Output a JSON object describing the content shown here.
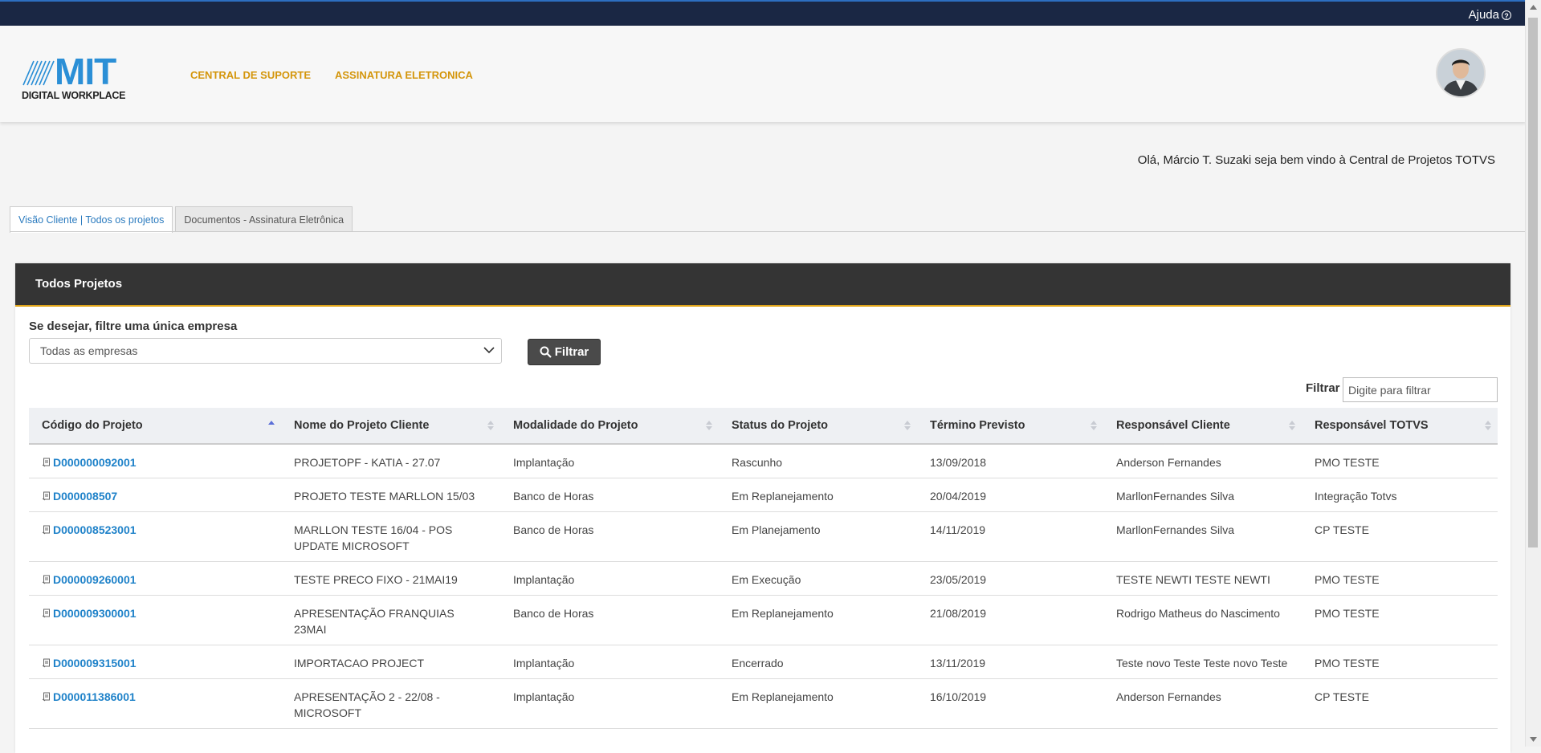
{
  "topbar": {
    "help_label": "Ajuda",
    "help_icon": "question-circle-icon"
  },
  "header": {
    "logo": {
      "brand": "MIT",
      "subtitle": "DIGITAL WORKPLACE"
    },
    "nav": [
      {
        "label": "CENTRAL DE SUPORTE"
      },
      {
        "label": "ASSINATURA ELETRONICA"
      }
    ]
  },
  "welcome_text": "Olá, Márcio T. Suzaki seja bem vindo à Central de Projetos TOTVS",
  "tabs": [
    {
      "label": "Visão Cliente | Todos os projetos",
      "active": true
    },
    {
      "label": "Documentos - Assinatura Eletrônica",
      "active": false
    }
  ],
  "panel": {
    "title": "Todos Projetos",
    "company_filter_label": "Se desejar, filtre uma única empresa",
    "company_select_value": "Todas as empresas",
    "filter_button": "Filtrar",
    "search_label": "Filtrar",
    "search_placeholder": "Digite para filtrar"
  },
  "table": {
    "columns": [
      "Código do Projeto",
      "Nome do Projeto Cliente",
      "Modalidade do Projeto",
      "Status do Projeto",
      "Término Previsto",
      "Responsável Cliente",
      "Responsável TOTVS"
    ],
    "rows": [
      [
        "D000000092001",
        "PROJETOPF - KATIA - 27.07",
        "Implantação",
        "Rascunho",
        "13/09/2018",
        "Anderson Fernandes",
        "PMO TESTE"
      ],
      [
        "D000008507",
        "PROJETO TESTE MARLLON 15/03",
        "Banco de Horas",
        "Em Replanejamento",
        "20/04/2019",
        "MarllonFernandes Silva",
        "Integração Totvs"
      ],
      [
        "D000008523001",
        "MARLLON TESTE 16/04 - POS UPDATE MICROSOFT",
        "Banco de Horas",
        "Em Planejamento",
        "14/11/2019",
        "MarllonFernandes Silva",
        "CP TESTE"
      ],
      [
        "D000009260001",
        "TESTE PRECO FIXO - 21MAI19",
        "Implantação",
        "Em Execução",
        "23/05/2019",
        "TESTE NEWTI TESTE NEWTI",
        "PMO TESTE"
      ],
      [
        "D000009300001",
        "APRESENTAÇÃO FRANQUIAS 23MAI",
        "Banco de Horas",
        "Em Replanejamento",
        "21/08/2019",
        "Rodrigo Matheus do Nascimento",
        "PMO TESTE"
      ],
      [
        "D000009315001",
        "IMPORTACAO PROJECT",
        "Implantação",
        "Encerrado",
        "13/11/2019",
        "Teste novo Teste Teste novo Teste",
        "PMO TESTE"
      ],
      [
        "D000011386001",
        "APRESENTAÇÃO 2 - 22/08 - MICROSOFT",
        "Implantação",
        "Em Replanejamento",
        "16/10/2019",
        "Anderson Fernandes",
        "CP TESTE"
      ]
    ]
  }
}
